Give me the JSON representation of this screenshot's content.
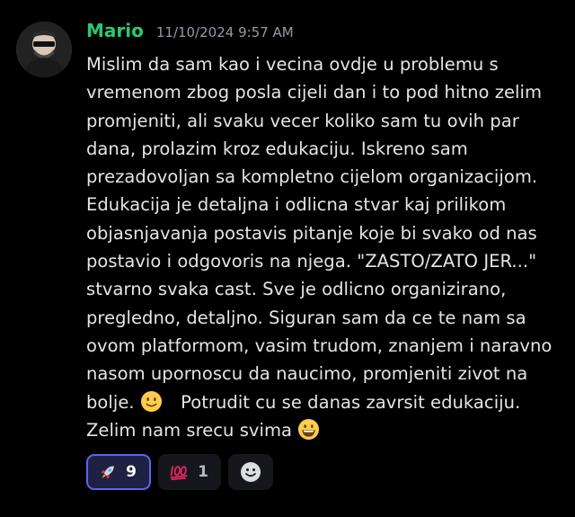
{
  "message": {
    "author": "Mario",
    "timestamp": "11/10/2024 9:57 AM",
    "avatar_icon": "person-with-sunglasses-avatar",
    "content_lines": [
      "Mislim da sam kao i vecina ovdje u problemu s",
      "vremenom zbog posla cijeli dan i to pod hitno zelim",
      "promjeniti, ali svaku vecer koliko sam tu ovih par",
      "dana, prolazim kroz edukaciju.  Iskreno sam",
      "prezadovoljan sa kompletno cijelom organizacijom.",
      "Edukacija je detaljna i odlicna stvar kaj prilikom",
      "objasnjavanja postavis pitanje koje bi svako od nas",
      "postavio i odgovoris na njega. \"ZASTO/ZATO JER...\"",
      "stvarno svaka cast. Sve je odlicno organizirano,",
      "pregledno, detaljno.  Siguran sam da ce te nam sa",
      "ovom platformom, vasim trudom, znanjem i naravno",
      "nasom upornoscu da naucimo, promjeniti zivot na"
    ],
    "line_13_before_emoji": "bolje.",
    "line_13_after_emoji": "Potrudit cu se danas zavrsit edukaciju.",
    "line_14": "Zelim nam srecu svima",
    "inline_emojis": [
      "slightly-smiling-face-emoji",
      "grinning-face-emoji"
    ]
  },
  "reactions": [
    {
      "icon": "rocket-emoji",
      "count": "9",
      "active": true
    },
    {
      "icon": "hundred-points-emoji",
      "count": "1",
      "active": false
    }
  ],
  "add_reaction": {
    "icon": "add-reaction-smiley-icon"
  },
  "colors": {
    "background": "#000000",
    "username": "#2dc770",
    "timestamp": "#949ba4",
    "text": "#e3e5e8",
    "reaction_active_border": "#5865f2",
    "reaction_active_bg": "#1f2142",
    "reaction_bg": "#16171c"
  }
}
